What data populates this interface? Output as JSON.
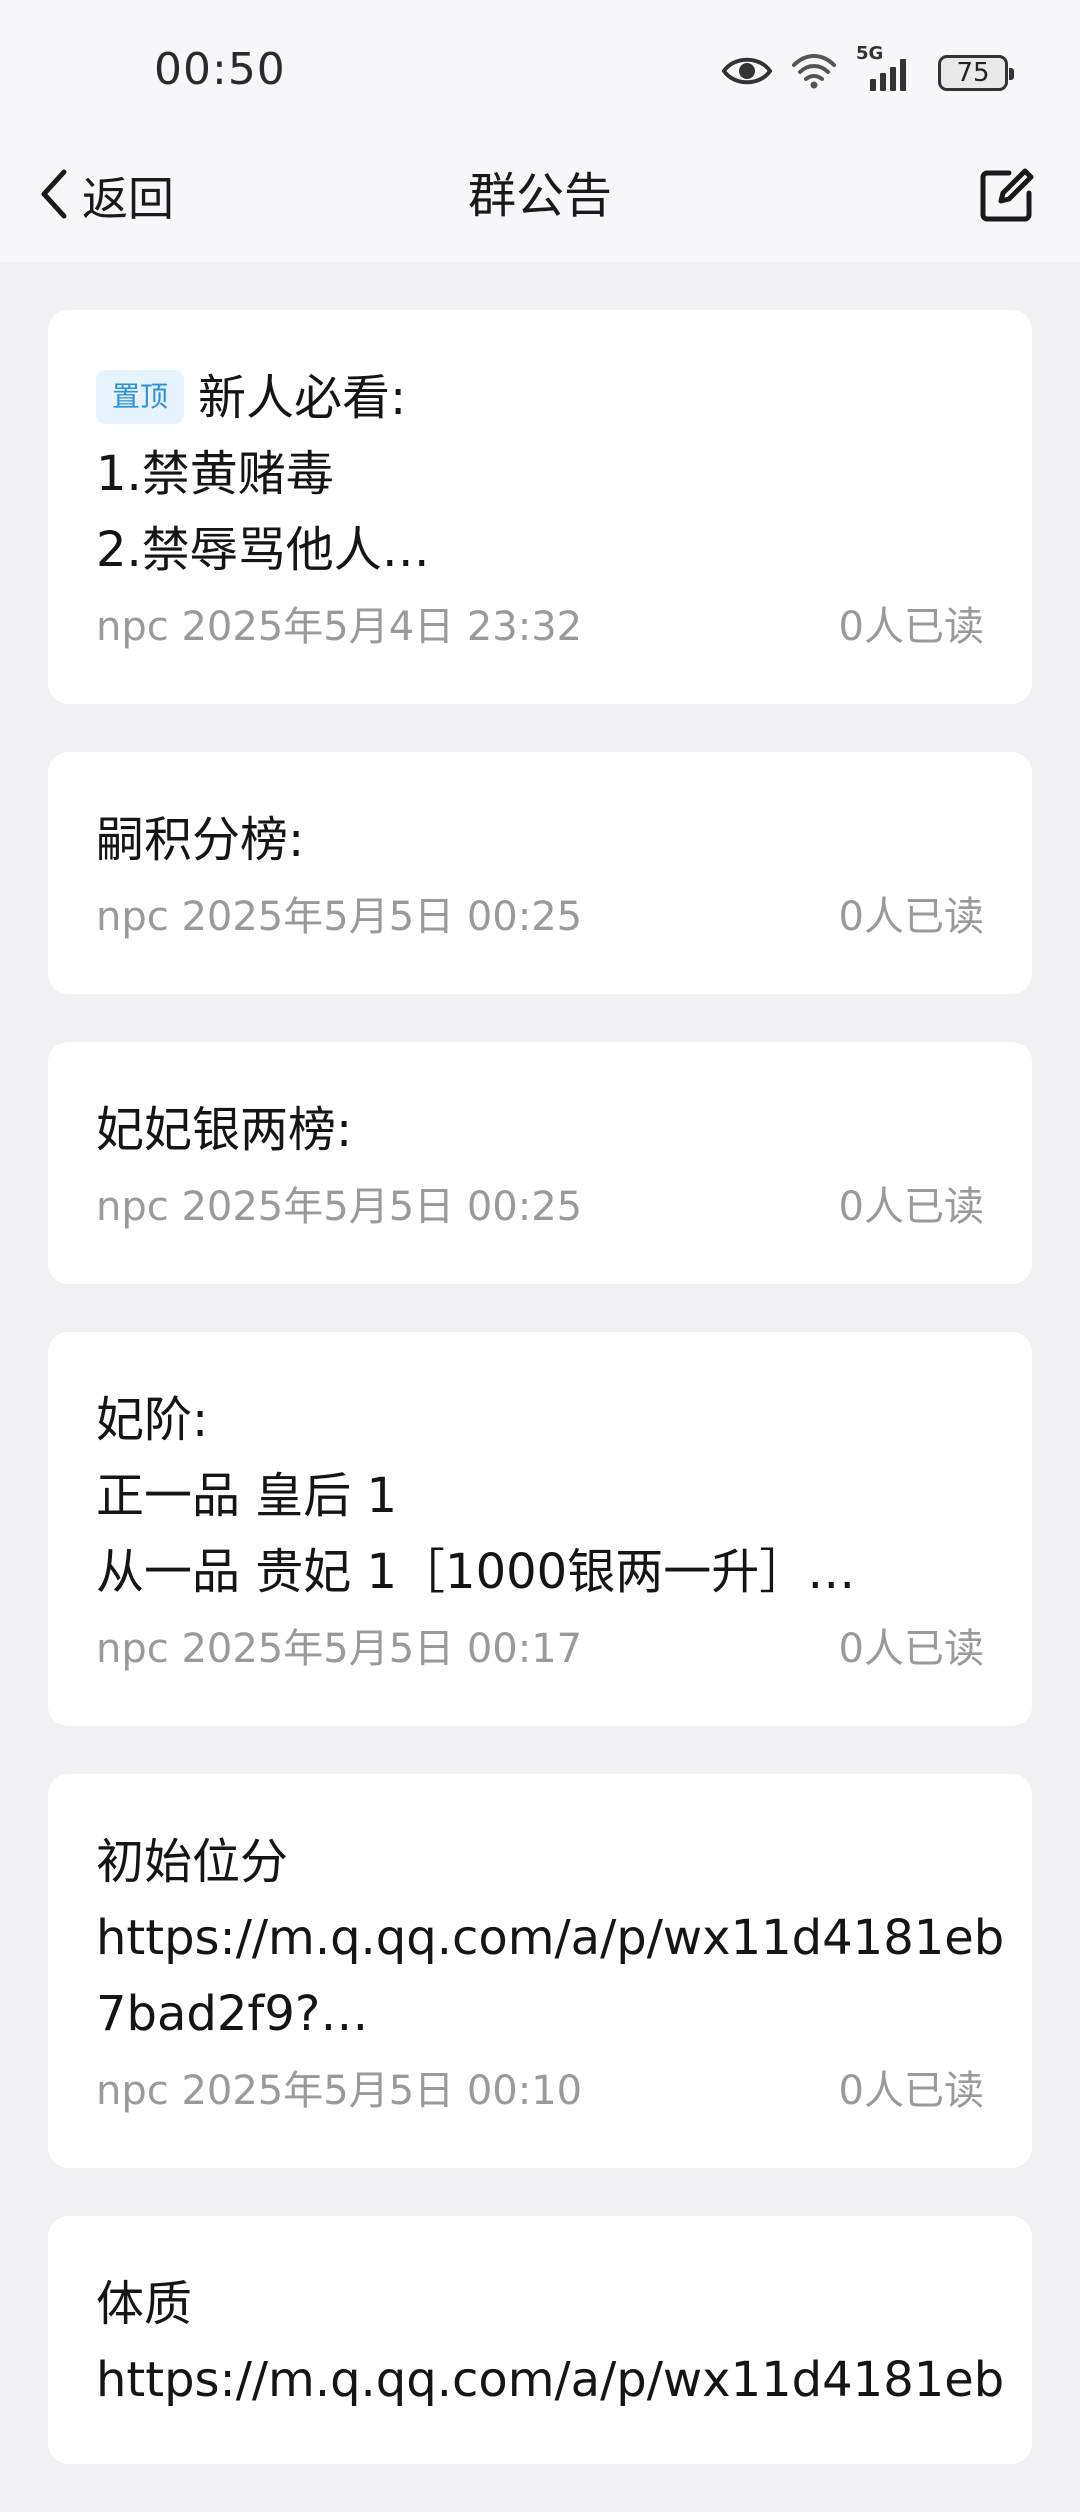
{
  "status_bar": {
    "time": "00:50",
    "network": "5G",
    "battery": "75"
  },
  "nav": {
    "back_label": "返回",
    "title": "群公告"
  },
  "announcements": [
    {
      "pinned": true,
      "pin_label": "置顶",
      "lines": [
        "新人必看:",
        "1.禁黄赌毒",
        "2.禁辱骂他人…"
      ],
      "author": "npc",
      "datetime": "2025年5月4日 23:32",
      "read_count": "0人已读"
    },
    {
      "lines": [
        "嗣积分榜:"
      ],
      "author": "npc",
      "datetime": "2025年5月5日 00:25",
      "read_count": "0人已读"
    },
    {
      "lines": [
        "妃妃银两榜:"
      ],
      "author": "npc",
      "datetime": "2025年5月5日 00:25",
      "read_count": "0人已读"
    },
    {
      "lines": [
        "妃阶:",
        "正一品 皇后 1",
        "从一品 贵妃 1［1000银两一升］…"
      ],
      "author": "npc",
      "datetime": "2025年5月5日 00:17",
      "read_count": "0人已读"
    },
    {
      "lines": [
        "初始位分",
        "https://m.q.qq.com/a/p/wx11d4181eb",
        "7bad2f9?…"
      ],
      "author": "npc",
      "datetime": "2025年5月5日 00:10",
      "read_count": "0人已读"
    },
    {
      "lines": [
        "体质",
        "https://m.q.qq.com/a/p/wx11d4181eb"
      ]
    }
  ]
}
